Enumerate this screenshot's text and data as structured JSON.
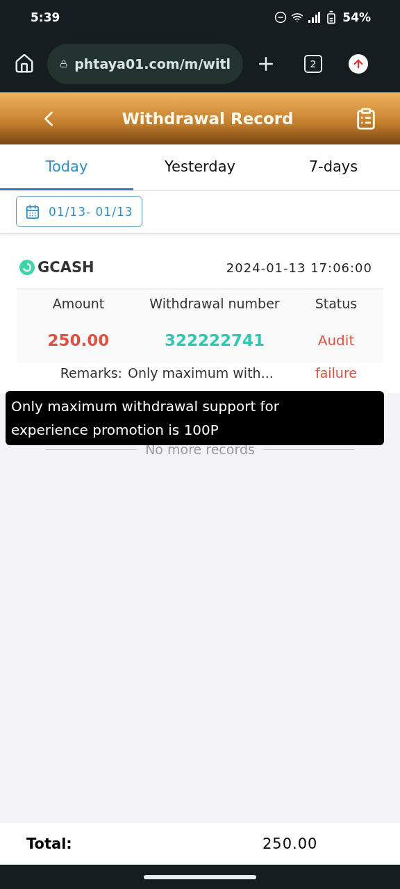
{
  "status_bar": {
    "time": "5:39",
    "battery": "54%"
  },
  "browser": {
    "url": "phtaya01.com/m/witl",
    "tab_count": "2"
  },
  "header": {
    "title": "Withdrawal Record"
  },
  "tabs": [
    {
      "label": "Today",
      "selected": true
    },
    {
      "label": "Yesterday",
      "selected": false
    },
    {
      "label": "7-days",
      "selected": false
    }
  ],
  "date_range": "01/13- 01/13",
  "records": [
    {
      "method": "GCASH",
      "datetime": "2024-01-13 17:06:00",
      "columns": [
        "Amount",
        "Withdrawal number",
        "Status"
      ],
      "amount": "250.00",
      "number": "322222741",
      "status": "Audit",
      "remarks_label": "Remarks:",
      "remarks": "Only maximum with...",
      "status_detail": "failure"
    }
  ],
  "end_note": "No more records",
  "tooltip": "Only maximum withdrawal support for experience promotion is 100P",
  "footer": {
    "label": "Total:",
    "total": "250.00"
  }
}
